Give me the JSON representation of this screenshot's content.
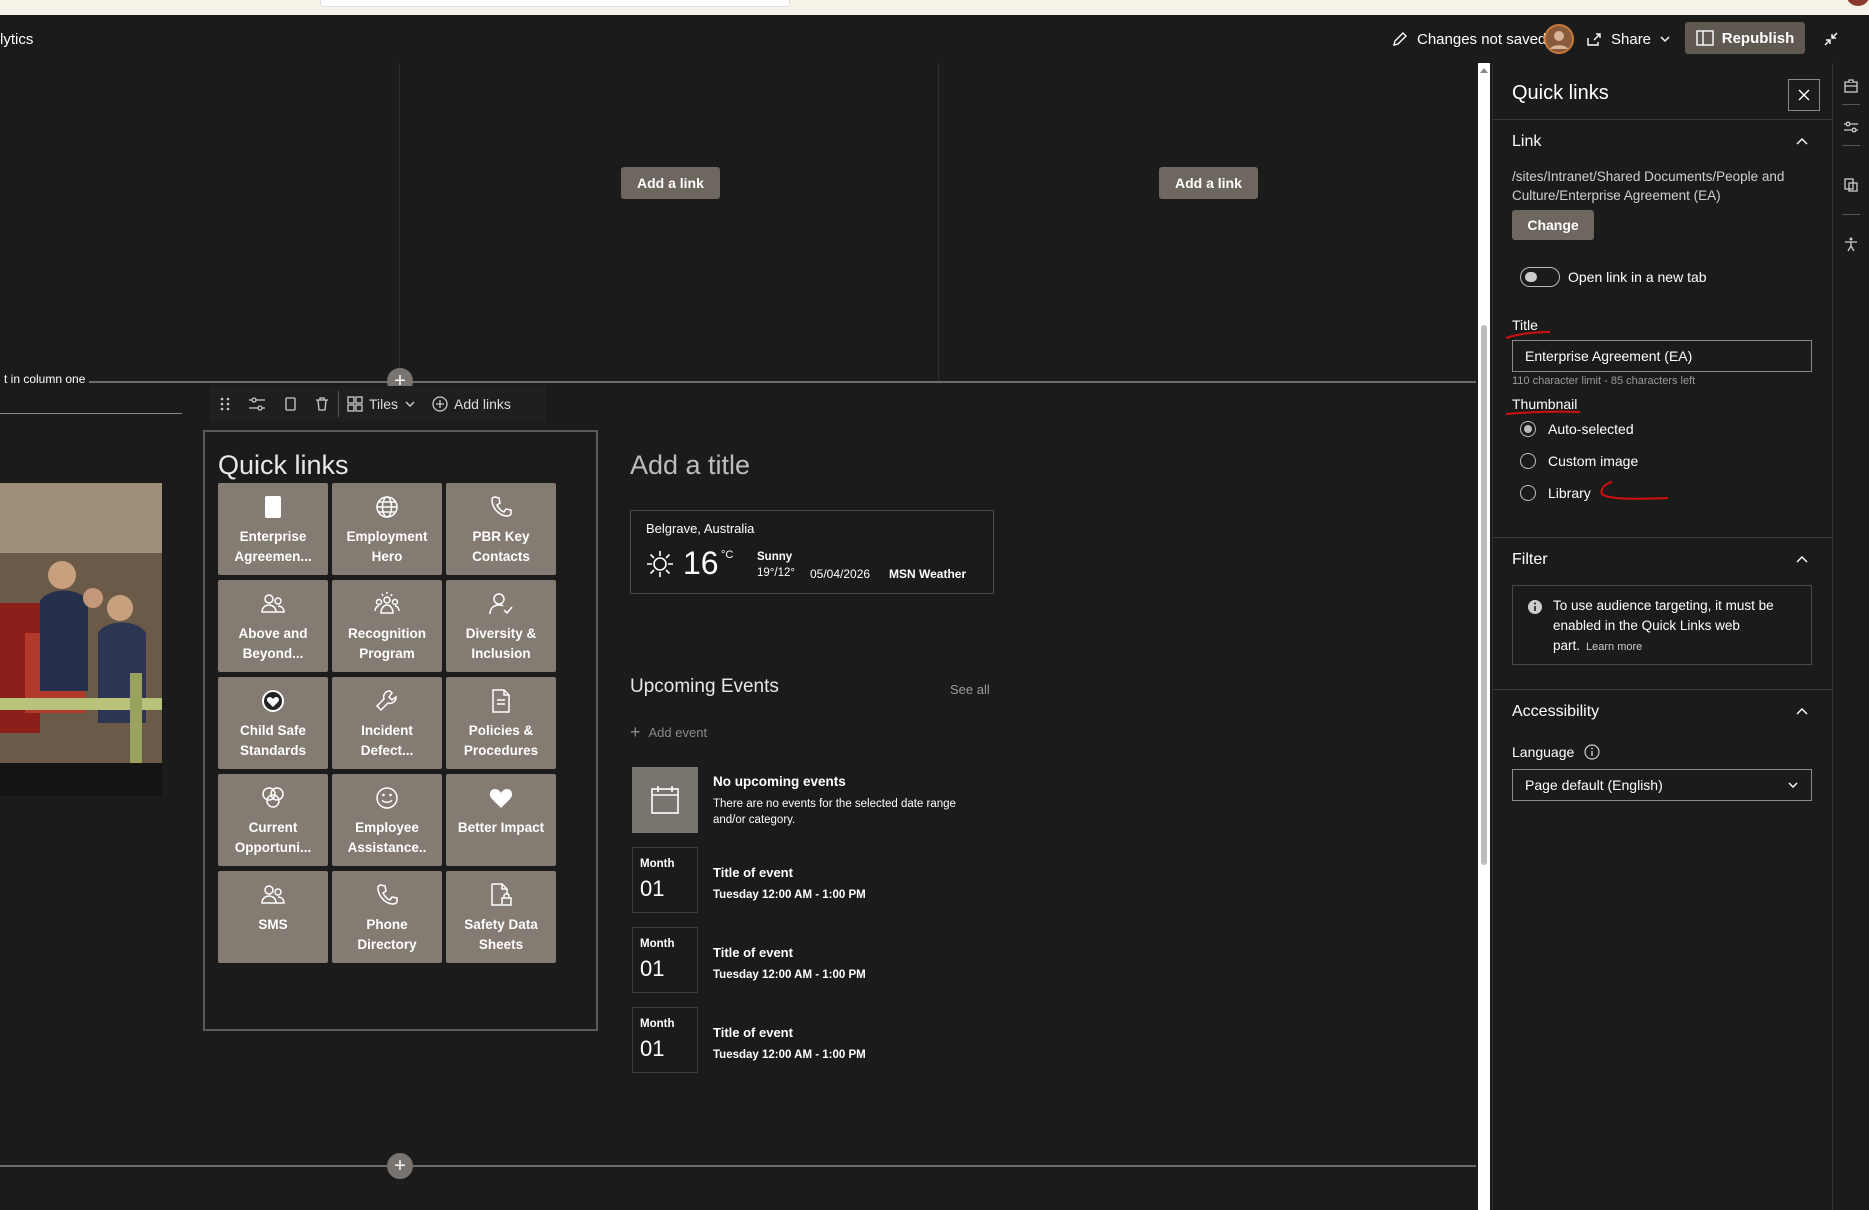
{
  "app": {
    "partial_title": "lytics"
  },
  "header": {
    "changes_status": "Changes not saved",
    "share_label": "Share",
    "republish_label": "Republish"
  },
  "canvas": {
    "add_link_label": "Add a link",
    "column_label": "t in column one"
  },
  "toolbar": {
    "layout_label": "Tiles",
    "add_links_label": "Add links"
  },
  "quick_links": {
    "title": "Quick links",
    "tiles": [
      {
        "label": "Enterprise Agreemen...",
        "icon": "document-icon"
      },
      {
        "label": "Employment Hero",
        "icon": "globe-icon"
      },
      {
        "label": "PBR Key Contacts",
        "icon": "phone-icon"
      },
      {
        "label": "Above and Beyond...",
        "icon": "people-icon"
      },
      {
        "label": "Recognition Program",
        "icon": "group-icon"
      },
      {
        "label": "Diversity & Inclusion",
        "icon": "person-icon"
      },
      {
        "label": "Child Safe Standards",
        "icon": "heart-badge-icon"
      },
      {
        "label": "Incident Defect...",
        "icon": "wrench-icon"
      },
      {
        "label": "Policies & Procedures",
        "icon": "page-icon"
      },
      {
        "label": "Current Opportuni...",
        "icon": "bubbles-icon"
      },
      {
        "label": "Employee Assistance..",
        "icon": "smiley-icon"
      },
      {
        "label": "Better Impact",
        "icon": "heart-icon"
      },
      {
        "label": "SMS",
        "icon": "people-icon"
      },
      {
        "label": "Phone Directory",
        "icon": "phone-icon"
      },
      {
        "label": "Safety Data Sheets",
        "icon": "page-lock-icon"
      }
    ]
  },
  "main": {
    "add_title_placeholder": "Add a title"
  },
  "weather": {
    "location": "Belgrave, Australia",
    "temp": "16",
    "unit": "°C",
    "condition": "Sunny",
    "range": "19°/12°",
    "date": "05/04/2026",
    "source": "MSN Weather"
  },
  "events": {
    "heading": "Upcoming Events",
    "see_all": "See all",
    "add_event": "Add event",
    "empty_title": "No upcoming events",
    "empty_desc_1": "There are no events for the selected date range",
    "empty_desc_2": "and/or category.",
    "items": [
      {
        "month": "Month",
        "day": "01",
        "title": "Title of event",
        "time": "Tuesday 12:00 AM - 1:00 PM"
      },
      {
        "month": "Month",
        "day": "01",
        "title": "Title of event",
        "time": "Tuesday 12:00 AM - 1:00 PM"
      },
      {
        "month": "Month",
        "day": "01",
        "title": "Title of event",
        "time": "Tuesday 12:00 AM - 1:00 PM"
      }
    ]
  },
  "panel": {
    "title": "Quick links",
    "link_section": "Link",
    "link_path_1": "/sites/Intranet/Shared Documents/People and",
    "link_path_2": "Culture/Enterprise Agreement (EA)",
    "change_label": "Change",
    "new_tab_label": "Open link in a new tab",
    "title_label": "Title",
    "title_value": "Enterprise Agreement (EA)",
    "char_limit": "110 character limit - 85 characters left",
    "thumbnail_label": "Thumbnail",
    "thumbnail_options": [
      "Auto-selected",
      "Custom image",
      "Library"
    ],
    "filter_section": "Filter",
    "filter_info_1": "To use audience targeting, it must be",
    "filter_info_2": "enabled in the Quick Links web",
    "filter_info_3": "part.",
    "learn_more": "Learn more",
    "accessibility_section": "Accessibility",
    "language_label": "Language",
    "language_value": "Page default (English)"
  }
}
